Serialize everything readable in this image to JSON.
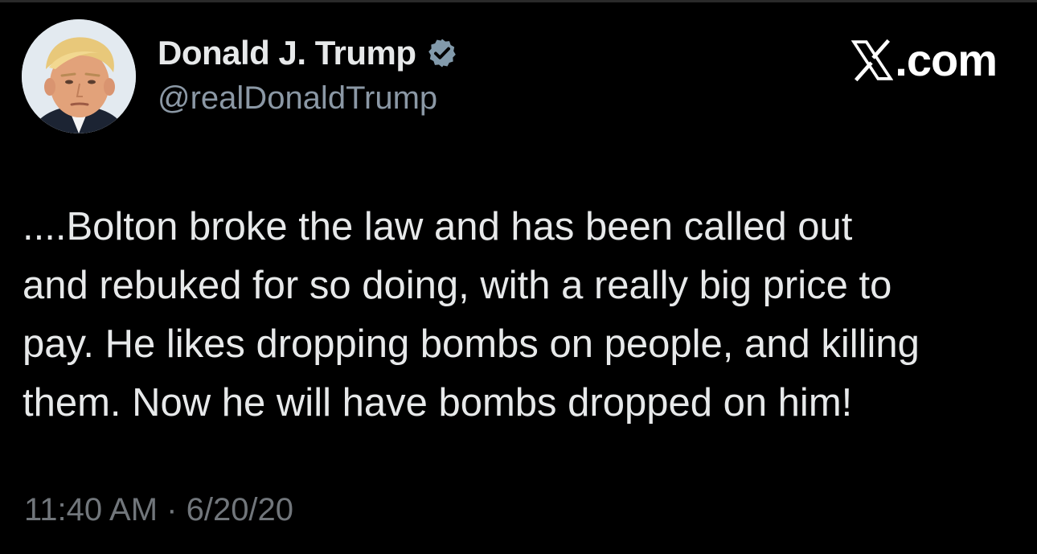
{
  "author": {
    "display_name": "Donald J. Trump",
    "handle": "@realDonaldTrump",
    "verified": true,
    "avatar_icon": "profile-photo"
  },
  "brand": {
    "label": ".com",
    "x_icon": "x-logo-icon"
  },
  "tweet": {
    "text": "....Bolton broke the law and has been called out\nand rebuked for so doing, with a really big price to\npay. He likes dropping bombs on people, and killing\nthem. Now he will have bombs dropped on him!",
    "timestamp": "11:40 AM · 6/20/20"
  },
  "colors": {
    "background": "#000000",
    "text_primary": "#e7e9ea",
    "text_secondary": "#71767b",
    "verified_badge": "#829aab"
  }
}
